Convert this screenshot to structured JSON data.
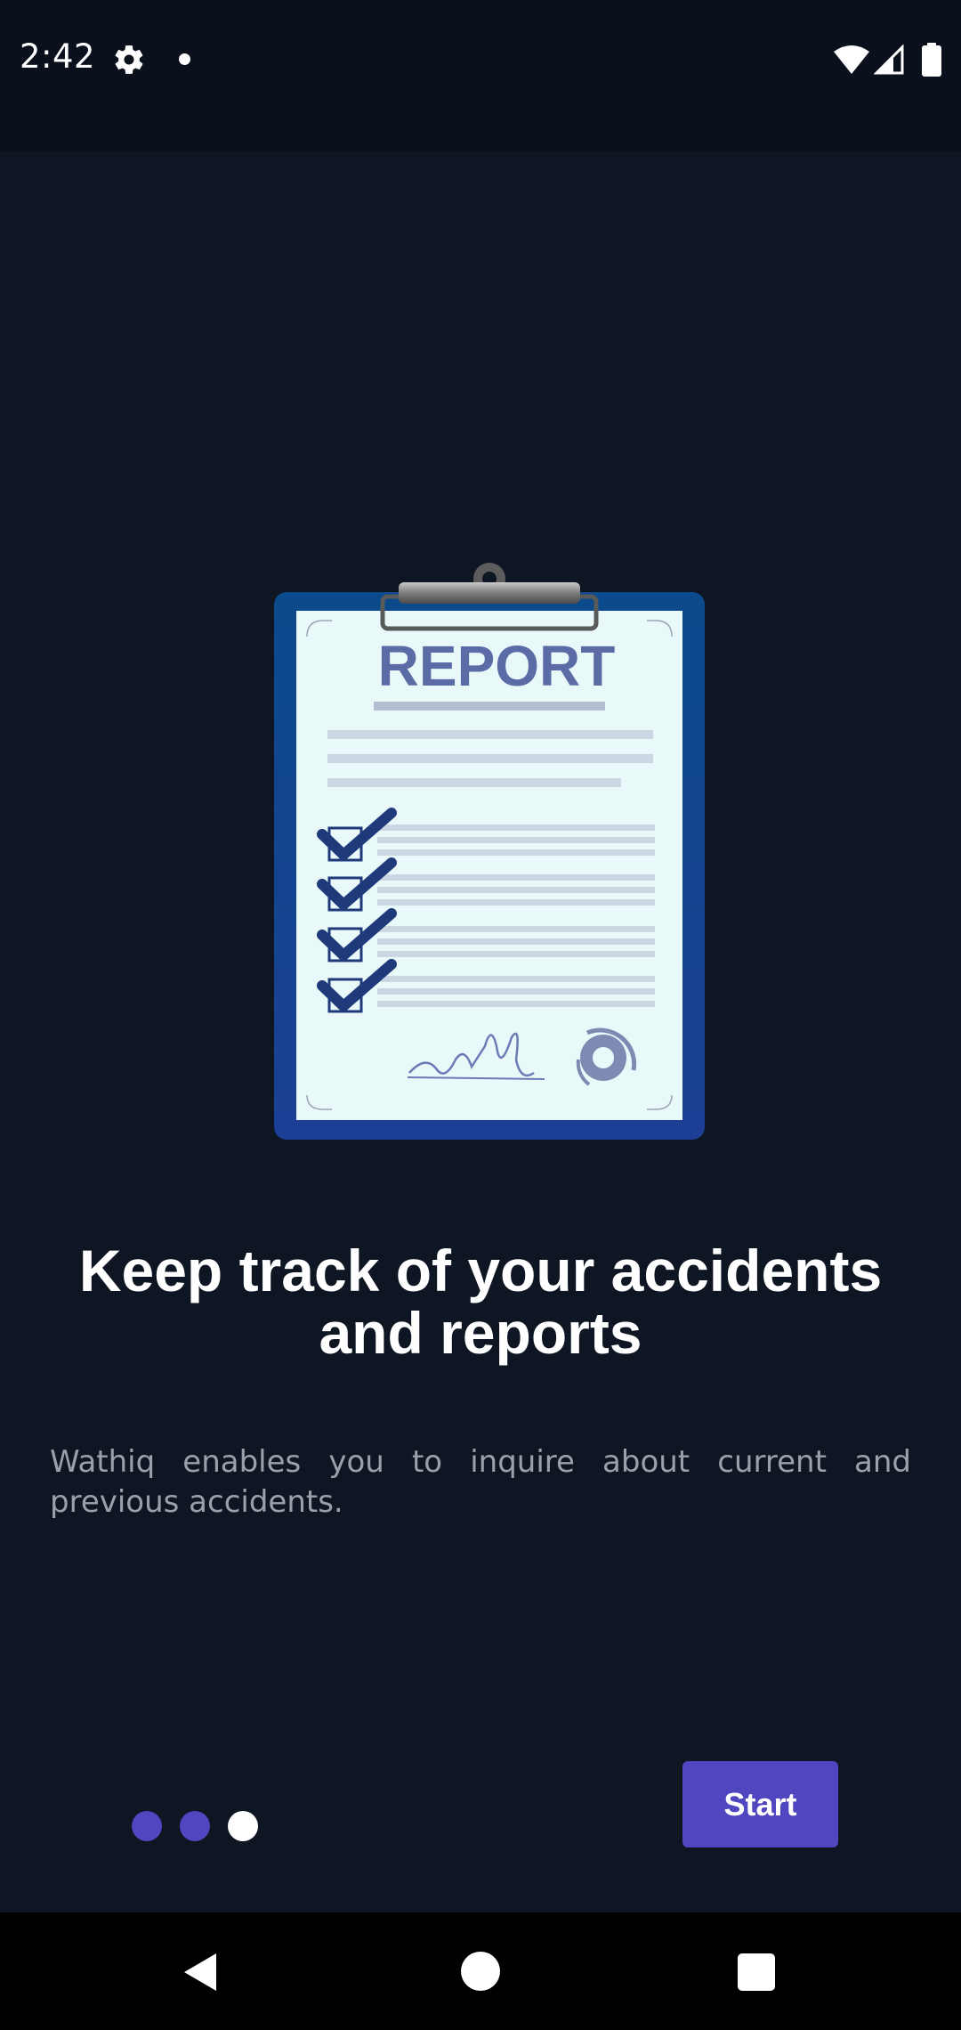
{
  "status_bar": {
    "time": "2:42",
    "icons": [
      "gear-icon",
      "notification-dot-icon",
      "wifi-icon",
      "signal-icon",
      "battery-icon"
    ]
  },
  "illustration": {
    "icon": "report-clipboard-illustration",
    "report_label": "REPORT"
  },
  "onboarding": {
    "headline": "Keep track of your accidents and reports",
    "description": "Wathiq enables you to inquire about current and previous accidents.",
    "pager": {
      "total": 3,
      "active_index": 2
    },
    "start_label": "Start"
  },
  "nav_bar": {
    "icons": [
      "back-icon",
      "home-icon",
      "recents-icon"
    ]
  },
  "colors": {
    "background": "#0e1624",
    "status_bar": "#0a111c",
    "accent": "#5046c0",
    "text_primary": "#ffffff",
    "text_secondary": "#9aa1ab"
  }
}
